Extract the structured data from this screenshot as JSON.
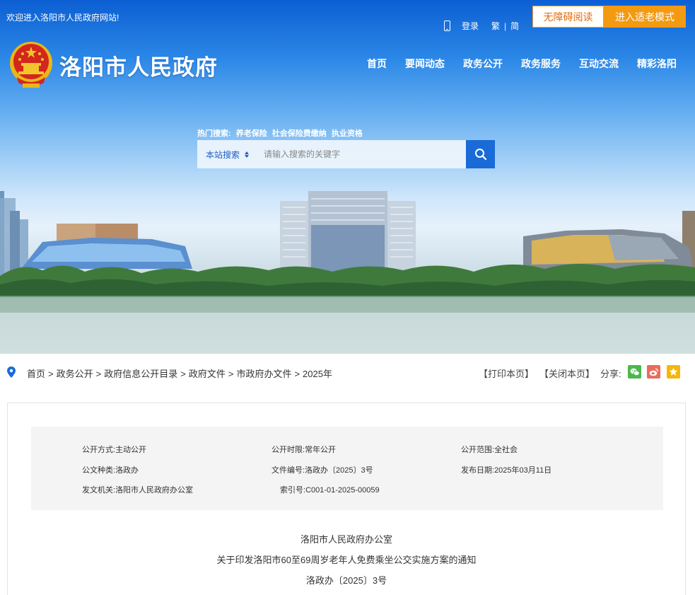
{
  "header": {
    "welcome": "欢迎进入洛阳市人民政府网站!",
    "links": {
      "login": "登录",
      "traditional": "繁",
      "divider": "|",
      "simplified": "简"
    },
    "accessibility_button": "无障碍阅读",
    "elder_mode_button": "进入适老模式",
    "site_title": "洛阳市人民政府",
    "nav": [
      "首页",
      "要闻动态",
      "政务公开",
      "政务服务",
      "互动交流",
      "精彩洛阳"
    ]
  },
  "search": {
    "hot_label": "热门搜索:",
    "hot_terms": [
      "养老保险",
      "社会保险费缴纳",
      "执业资格"
    ],
    "scope": "本站搜索",
    "placeholder": "请输入搜索的关键字"
  },
  "breadcrumb": {
    "items": [
      "首页",
      "政务公开",
      "政府信息公开目录",
      "政府文件",
      "市政府办文件",
      "2025年"
    ],
    "separator": ">"
  },
  "tools": {
    "print": "【打印本页】",
    "close": "【关闭本页】",
    "share_label": "分享:"
  },
  "meta": {
    "disclosure_method": {
      "label": "公开方式:",
      "value": "主动公开"
    },
    "disclosure_period": {
      "label": "公开时限:",
      "value": "常年公开"
    },
    "disclosure_scope": {
      "label": "公开范围:",
      "value": "全社会"
    },
    "doc_type": {
      "label": "公文种类:",
      "value": "洛政办"
    },
    "doc_number": {
      "label": "文件编号:",
      "value": "洛政办〔2025〕3号"
    },
    "publish_date": {
      "label": "发布日期:",
      "value": "2025年03月11日"
    },
    "issuer": {
      "label": "发文机关:",
      "value": "洛阳市人民政府办公室"
    },
    "index_number": {
      "label": "索引号:",
      "value": "C001-01-2025-00059"
    }
  },
  "document": {
    "issuer": "洛阳市人民政府办公室",
    "title": "关于印发洛阳市60至69周岁老年人免费乘坐公交实施方案的通知",
    "number": "洛政办〔2025〕3号"
  },
  "colors": {
    "primary_blue": "#1a6ad8",
    "elder_orange": "#f39a12",
    "access_text": "#e36b0c"
  }
}
